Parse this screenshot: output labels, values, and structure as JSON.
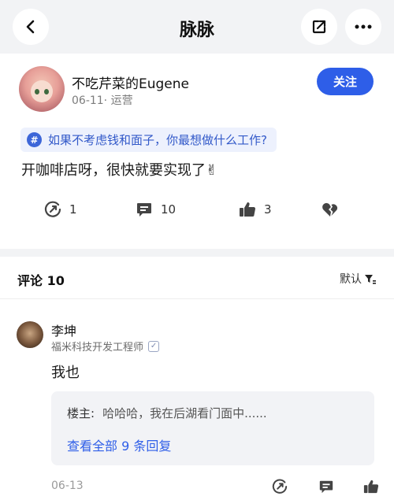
{
  "header": {
    "title": "脉脉"
  },
  "post": {
    "author": {
      "name": "不吃芹菜的Eugene",
      "meta": "06-11· 运营"
    },
    "follow_label": "关注",
    "topic": {
      "hash": "#",
      "text": "如果不考虑钱和面子，你最想做什么工作?"
    },
    "text": "开咖啡店呀，很快就要实现了✌",
    "actions": {
      "repost_count": "1",
      "comment_count": "10",
      "like_count": "3"
    }
  },
  "comments": {
    "title": "评论 10",
    "sort_label": "默认",
    "items": [
      {
        "name": "李坤",
        "title": "福米科技开发工程师",
        "text": "我也",
        "reply": {
          "who": "楼主:",
          "text": "哈哈哈，我在后湖看门面中......"
        },
        "view_all": "查看全部 9 条回复",
        "date": "06-13"
      }
    ]
  },
  "colors": {
    "accent": "#2e5ee8",
    "band": "#f2f3f5"
  }
}
